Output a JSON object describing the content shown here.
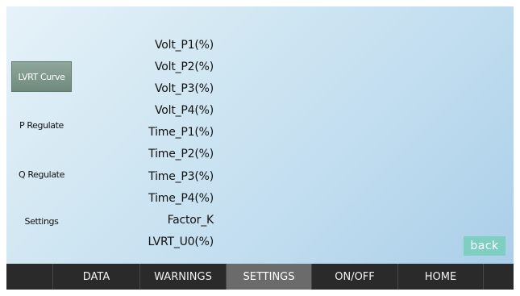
{
  "sidebar": {
    "items": [
      {
        "label": "LVRT Curve",
        "active": true
      },
      {
        "label": "P Regulate",
        "active": false
      },
      {
        "label": "Q Regulate",
        "active": false
      },
      {
        "label": "Settings",
        "active": false
      }
    ]
  },
  "params": [
    "Volt_P1(%)",
    "Volt_P2(%)",
    "Volt_P3(%)",
    "Volt_P4(%)",
    "Time_P1(%)",
    "Time_P2(%)",
    "Time_P3(%)",
    "Time_P4(%)",
    "Factor_K",
    "LVRT_U0(%)"
  ],
  "back_label": "back",
  "nav": {
    "tabs": [
      {
        "label": "DATA",
        "active": false
      },
      {
        "label": "WARNINGS",
        "active": false
      },
      {
        "label": "SETTINGS",
        "active": true
      },
      {
        "label": "ON/OFF",
        "active": false
      },
      {
        "label": "HOME",
        "active": false
      }
    ]
  },
  "colors": {
    "active_sidebar": "#7a9488",
    "back_button": "#7ecfc1",
    "nav_bar": "#2a2a2a",
    "nav_active": "#6b6b6b"
  }
}
